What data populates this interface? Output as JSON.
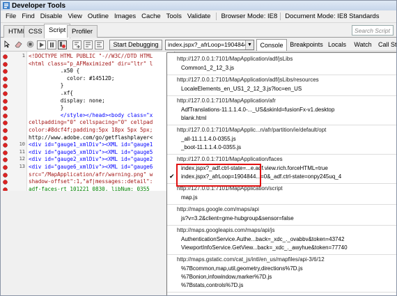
{
  "window": {
    "title": "Developer Tools"
  },
  "menu": [
    "File",
    "Find",
    "Disable",
    "View",
    "Outline",
    "Images",
    "Cache",
    "Tools",
    "Validate",
    "Browser Mode: IE8",
    "Document Mode: IE8 Standards"
  ],
  "tabs": [
    {
      "label": "HTML"
    },
    {
      "label": "CSS"
    },
    {
      "label": "Script"
    },
    {
      "label": "Profiler"
    }
  ],
  "search": {
    "placeholder": "Search Script"
  },
  "toolbar": {
    "start_debugging": "Start Debugging",
    "script_select": "index.jspx?_afrLoop=1904844…",
    "panes": [
      "Console",
      "Breakpoints",
      "Locals",
      "Watch",
      "Call St"
    ]
  },
  "editor": {
    "lines": [
      {
        "num": "1",
        "text": "<!DOCTYPE HTML PUBLIC \"-//W3C//DTD HTML",
        "style": "red"
      },
      {
        "num": "",
        "text": "<html class=\"p_AFMaximized\" dir=\"ltr\" l",
        "style": "red"
      },
      {
        "num": "",
        "text": "          .x50 {",
        "style": ""
      },
      {
        "num": "",
        "text": "            color: #14512D;",
        "style": ""
      },
      {
        "num": "",
        "text": "          }",
        "style": ""
      },
      {
        "num": "",
        "text": "          .xf{",
        "style": ""
      },
      {
        "num": "",
        "text": "          display: none;",
        "style": ""
      },
      {
        "num": "",
        "text": "          }",
        "style": ""
      },
      {
        "num": "",
        "text": "          </style></head><body class=\"x",
        "style": "blue"
      },
      {
        "num": "",
        "text": "cellpadding=\"0\" cellspacing=\"0\" cellpad",
        "style": "red"
      },
      {
        "num": "",
        "text": "color:#8dcf4f;padding:5px 18px 5px 5px;",
        "style": "red"
      },
      {
        "num": "",
        "text": "http://www.adobe.com/go/getflashplayer<",
        "style": ""
      },
      {
        "num": "10",
        "text": "<div id=\"gauge1_xmlDiv\"><XML id=\"gauge1",
        "style": "blue"
      },
      {
        "num": "11",
        "text": "<div id=\"gauge5_xmlDiv\"><XML id=\"gauge5",
        "style": "blue"
      },
      {
        "num": "12",
        "text": "<div id=\"gauge2_xmlDiv\"><XML id=\"gauge2",
        "style": "blue"
      },
      {
        "num": "13",
        "text": "<div id=\"gauge6_xmlDiv\"><XML id=\"gauge6",
        "style": "blue"
      },
      {
        "num": "",
        "text": "src=\"/MapApplication/afr/warning.png\" w",
        "style": "red"
      },
      {
        "num": "",
        "text": "shadow-offset\":1,\"af|messages::detail\":",
        "style": "red"
      },
      {
        "num": "",
        "text": "adf-faces-rt_101221_0830, libNum: 0355",
        "style": "green"
      }
    ]
  },
  "script_list": [
    {
      "header": "http://127.0.0.1:7101/MapApplication/adf/jsLibs",
      "items": [
        "Common1_2_12_3.js"
      ]
    },
    {
      "header": "http://127.0.0.1:7101/MapApplication/adf/jsLibs/resources",
      "items": [
        "LocaleElements_en_US1_2_12_3.js?loc=en_US"
      ]
    },
    {
      "header": "http://127.0.0.1:7101/MapApplication/afr",
      "items": [
        "AdfTranslations-11.1.1.4.0-..._US&skinId=fusionFx-v1.desktop",
        "blank.html"
      ]
    },
    {
      "header": "http://127.0.0.1:7101/MapApplic...n/afr/partition/ie/default/opt",
      "items": [
        "_all-11.1.1.4.0-0355.js",
        "_boot-11.1.1.4.0-0355.js"
      ]
    },
    {
      "header": "http://127.0.0.1:7101/MapApplication/faces",
      "items": [
        "index.jspx?_adf.ctrl-state=...e.adf.view.rich.forceHTML=true",
        "index.jspx?_afrLoop=1904844...=0&_adf.ctrl-state=onpy245uq_4"
      ],
      "checked_index": 1
    },
    {
      "header": "http://127.0.0.1:7101/MapApplication/script",
      "items": [
        "map.js"
      ]
    },
    {
      "header": "http://maps.google.com/maps/api",
      "items": [
        "js?v=3.2&client=gme-hubgroup&sensor=false"
      ]
    },
    {
      "header": "http://maps.googleapis.com/maps/api/js",
      "items": [
        "AuthenticationService.Authe...back=_xdc_._ovabbv&token=43742",
        "ViewportInfoService.GetView...back=_xdc_._awyhue&token=77740"
      ]
    },
    {
      "header": "http://maps.gstatic.com/cat_js/intl/en_us/mapfiles/api-3/6/12",
      "items": [
        "%7Bcommon,map,util,geometry,directions%7D.js",
        "%7Bonion,infowindow,marker%7D.js",
        "%7Bstats,controls%7D.js"
      ]
    }
  ],
  "colors": {
    "highlight": "#e01010",
    "window_bg": "#f0f0f0",
    "title_bar": "#c7d6ea"
  }
}
